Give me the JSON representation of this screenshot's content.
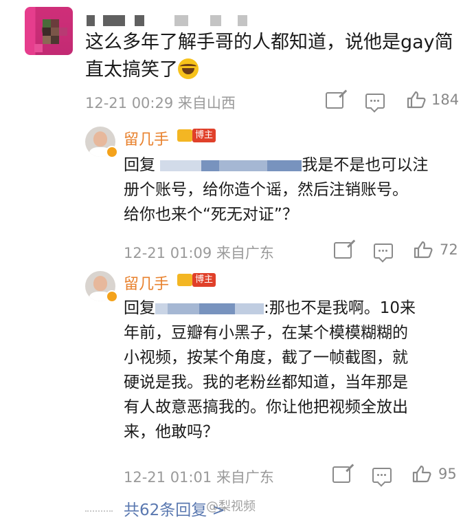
{
  "main_comment": {
    "text_line1": "这么多年了解手哥的人都知道，说他是gay简",
    "text_line2": "直太搞笑了",
    "time": "12-21 00:29",
    "source": "来自山西",
    "likes": "184"
  },
  "replies": [
    {
      "name": "留几手",
      "badge": "博主",
      "reply_prefix": "回复",
      "line1_tail": "我是不是也可以注",
      "line2": "册个账号，给你造个谣，然后注销账号。",
      "line3": "给你也来个“死无对证”？",
      "time": "12-21 01:09",
      "source": "来自广东",
      "likes": "72"
    },
    {
      "name": "留几手",
      "badge": "博主",
      "reply_prefix": "回复",
      "line1_tail": ":那也不是我啊。10来",
      "line2": "年前，豆瓣有小黑子，在某个模模糊糊的",
      "line3": "小视频，按某个角度，截了一帧截图，就",
      "line4": "硬说是我。我的老粉丝都知道，当年那是",
      "line5": "有人故意恶搞我的。你让他把视频全放出",
      "line6": "来，他敢吗？",
      "time": "12-21 01:01",
      "source": "来自广东",
      "likes": "95"
    }
  ],
  "footer": {
    "more_replies": "共62条回复 >",
    "watermark": "@梨视频"
  },
  "colors": {
    "accent_name": "#e8812d",
    "link": "#5a78b0",
    "meta": "#9a9a9a"
  }
}
